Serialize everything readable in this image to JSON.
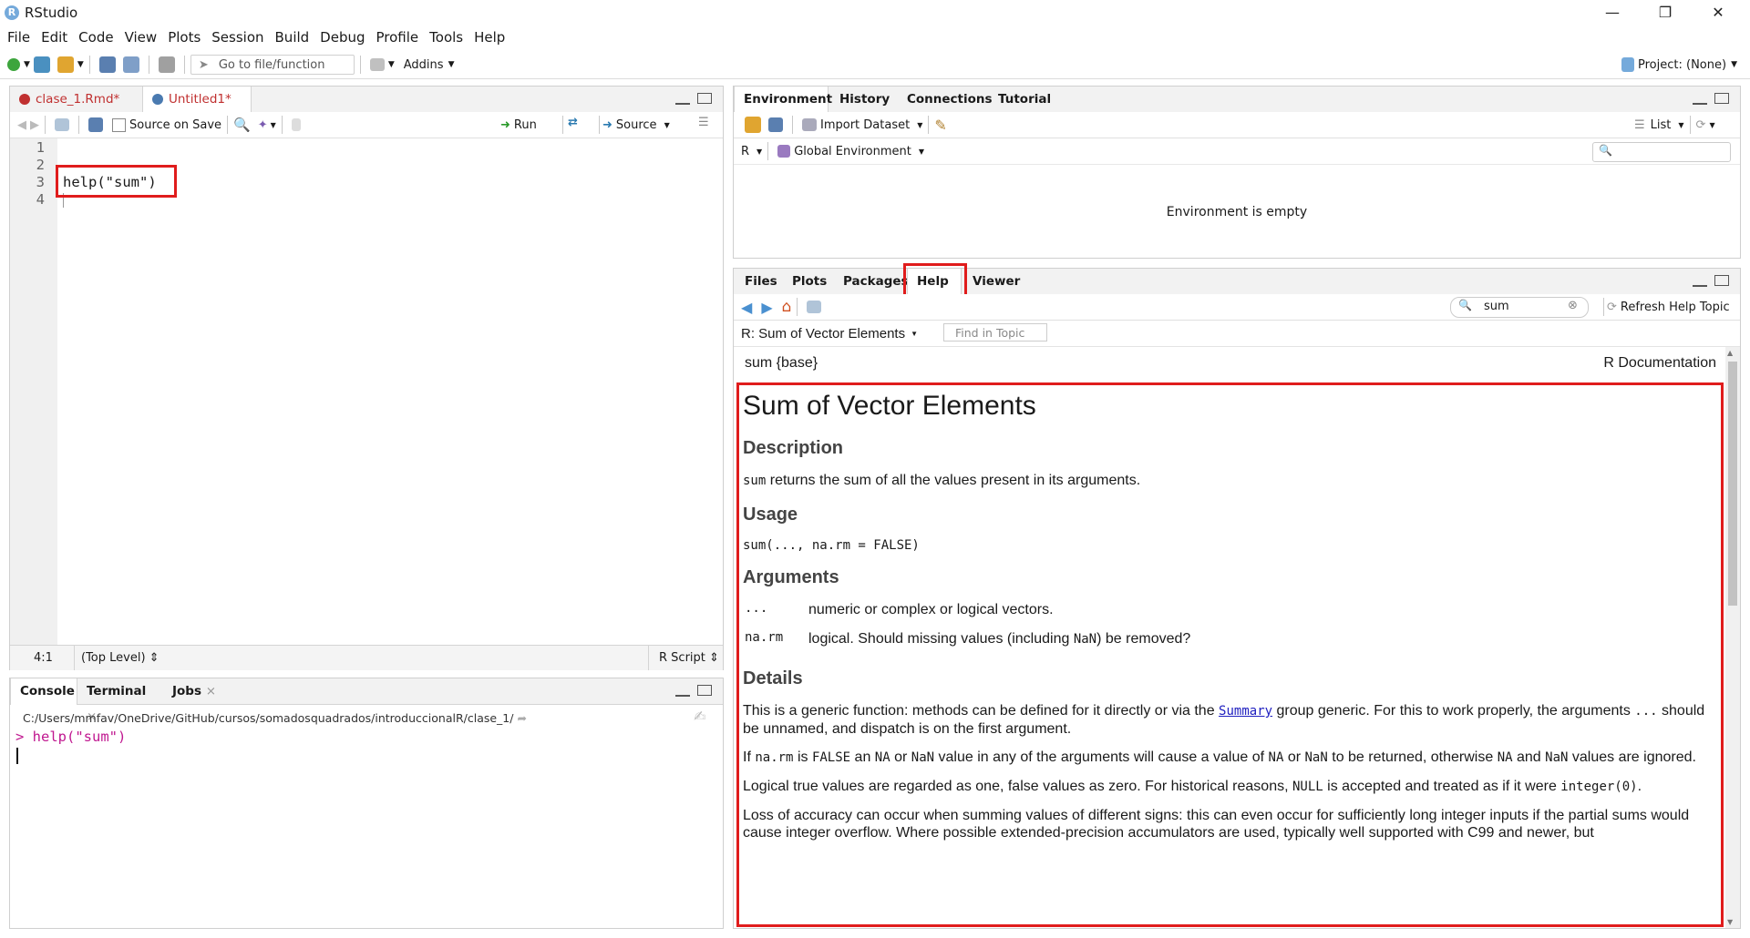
{
  "window": {
    "title": "RStudio",
    "app_icon": "R"
  },
  "menu": [
    "File",
    "Edit",
    "Code",
    "View",
    "Plots",
    "Session",
    "Build",
    "Debug",
    "Profile",
    "Tools",
    "Help"
  ],
  "toolbar": {
    "goto_placeholder": "Go to file/function",
    "addins": "Addins",
    "project": "Project: (None)"
  },
  "source_pane": {
    "tabs": [
      {
        "label": "clase_1.Rmd*"
      },
      {
        "label": "Untitled1*"
      }
    ],
    "source_on_save": "Source on Save",
    "run": "Run",
    "source": "Source",
    "line_numbers": [
      "1",
      "2",
      "3",
      "4"
    ],
    "code_line_3": "help(\"sum\")",
    "status_position": "4:1",
    "status_scope": "(Top Level)",
    "status_type": "R Script"
  },
  "console_pane": {
    "tabs": [
      "Console",
      "Terminal",
      "Jobs"
    ],
    "path": "C:/Users/mmfav/OneDrive/GitHub/cursos/somadosquadrados/introduccionalR/clase_1/",
    "command": "> help(\"sum\")"
  },
  "env_pane": {
    "tabs": [
      "Environment",
      "History",
      "Connections",
      "Tutorial"
    ],
    "import_dataset": "Import Dataset",
    "list_label": "List",
    "r_label": "R",
    "global_env": "Global Environment",
    "empty_msg": "Environment is empty"
  },
  "help_pane": {
    "tabs": [
      "Files",
      "Plots",
      "Packages",
      "Help",
      "Viewer"
    ],
    "search_value": "sum",
    "refresh": "Refresh Help Topic",
    "topic": "R: Sum of Vector Elements",
    "find_placeholder": "Find in Topic",
    "header_left": "sum {base}",
    "header_right": "R Documentation",
    "title": "Sum of Vector Elements",
    "h_description": "Description",
    "desc_code": "sum",
    "desc_text": " returns the sum of all the values present in its arguments.",
    "h_usage": "Usage",
    "usage": "sum(..., na.rm = FALSE)",
    "h_arguments": "Arguments",
    "arg1_name": "...",
    "arg1_desc": "numeric or complex or logical vectors.",
    "arg2_name": "na.rm",
    "arg2_desc_a": "logical. Should missing values (including ",
    "arg2_desc_code": "NaN",
    "arg2_desc_b": ") be removed?",
    "h_details": "Details",
    "d1_a": "This is a generic function: methods can be defined for it directly or via the ",
    "d1_link": "Summary",
    "d1_b": " group generic. For this to work properly, the arguments ",
    "d1_code": "...",
    "d1_c": " should be unnamed, and dispatch is on the first argument.",
    "d2_a": "If ",
    "d2_c1": "na.rm",
    "d2_b": " is ",
    "d2_c2": "FALSE",
    "d2_c": " an ",
    "d2_c3": "NA",
    "d2_d": " or ",
    "d2_c4": "NaN",
    "d2_e": " value in any of the arguments will cause a value of ",
    "d2_c5": "NA",
    "d2_f": " or ",
    "d2_c6": "NaN",
    "d2_g": " to be returned, otherwise ",
    "d2_c7": "NA",
    "d2_h": " and ",
    "d2_c8": "NaN",
    "d2_i": " values are ignored.",
    "d3_a": "Logical true values are regarded as one, false values as zero. For historical reasons, ",
    "d3_c1": "NULL",
    "d3_b": " is accepted and treated as if it were ",
    "d3_c2": "integer(0)",
    "d3_c": ".",
    "d4": "Loss of accuracy can occur when summing values of different signs: this can even occur for sufficiently long integer inputs if the partial sums would cause integer overflow. Where possible extended-precision accumulators are used, typically well supported with C99 and newer, but"
  },
  "colors": {
    "highlight_red": "#e01c1c",
    "r_blue": "#75aadb",
    "console_command": "#c01890"
  }
}
